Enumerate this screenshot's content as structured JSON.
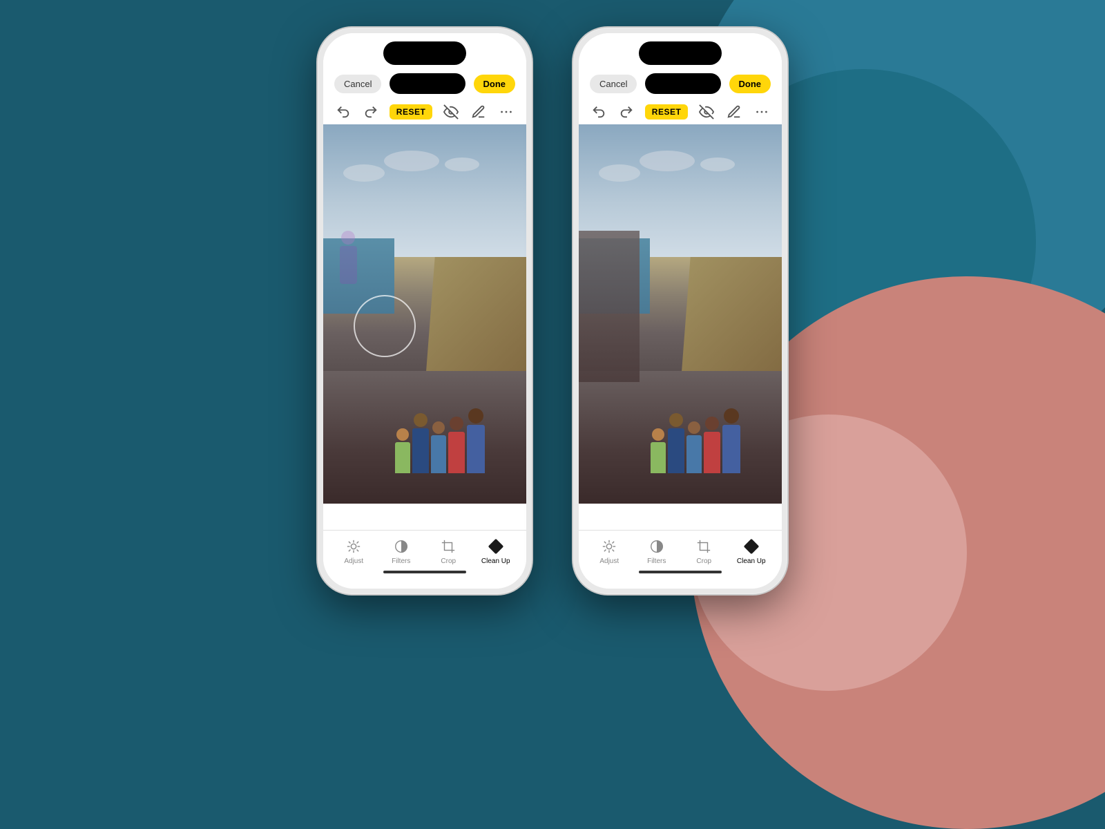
{
  "background": {
    "base_color": "#1a5a6e"
  },
  "phones": [
    {
      "id": "phone-left",
      "state": "before",
      "top_bar": {
        "cancel_label": "Cancel",
        "done_label": "Done",
        "reset_label": "RESET"
      },
      "has_circle_selection": true,
      "has_ghost_person": true,
      "bottom_toolbar": {
        "tabs": [
          {
            "id": "adjust",
            "label": "Adjust",
            "icon": "sun-icon",
            "active": false
          },
          {
            "id": "filters",
            "label": "Filters",
            "icon": "circle-half-icon",
            "active": false
          },
          {
            "id": "crop",
            "label": "Crop",
            "icon": "crop-icon",
            "active": false
          },
          {
            "id": "cleanup",
            "label": "Clean Up",
            "icon": "diamond-icon",
            "active": true
          }
        ]
      }
    },
    {
      "id": "phone-right",
      "state": "after",
      "top_bar": {
        "cancel_label": "Cancel",
        "done_label": "Done",
        "reset_label": "RESET"
      },
      "has_circle_selection": false,
      "has_ghost_person": false,
      "bottom_toolbar": {
        "tabs": [
          {
            "id": "adjust",
            "label": "Adjust",
            "icon": "sun-icon",
            "active": false
          },
          {
            "id": "filters",
            "label": "Filters",
            "icon": "circle-half-icon",
            "active": false
          },
          {
            "id": "crop",
            "label": "Crop",
            "icon": "crop-icon",
            "active": false
          },
          {
            "id": "cleanup",
            "label": "Clean Up",
            "icon": "diamond-icon",
            "active": true
          }
        ]
      }
    }
  ],
  "icons": {
    "undo": "↩",
    "redo": "↪",
    "eye_slash": "👁",
    "pen": "✏",
    "more": "•••",
    "sun": "☀",
    "circle_half": "◑",
    "crop": "⊞"
  }
}
